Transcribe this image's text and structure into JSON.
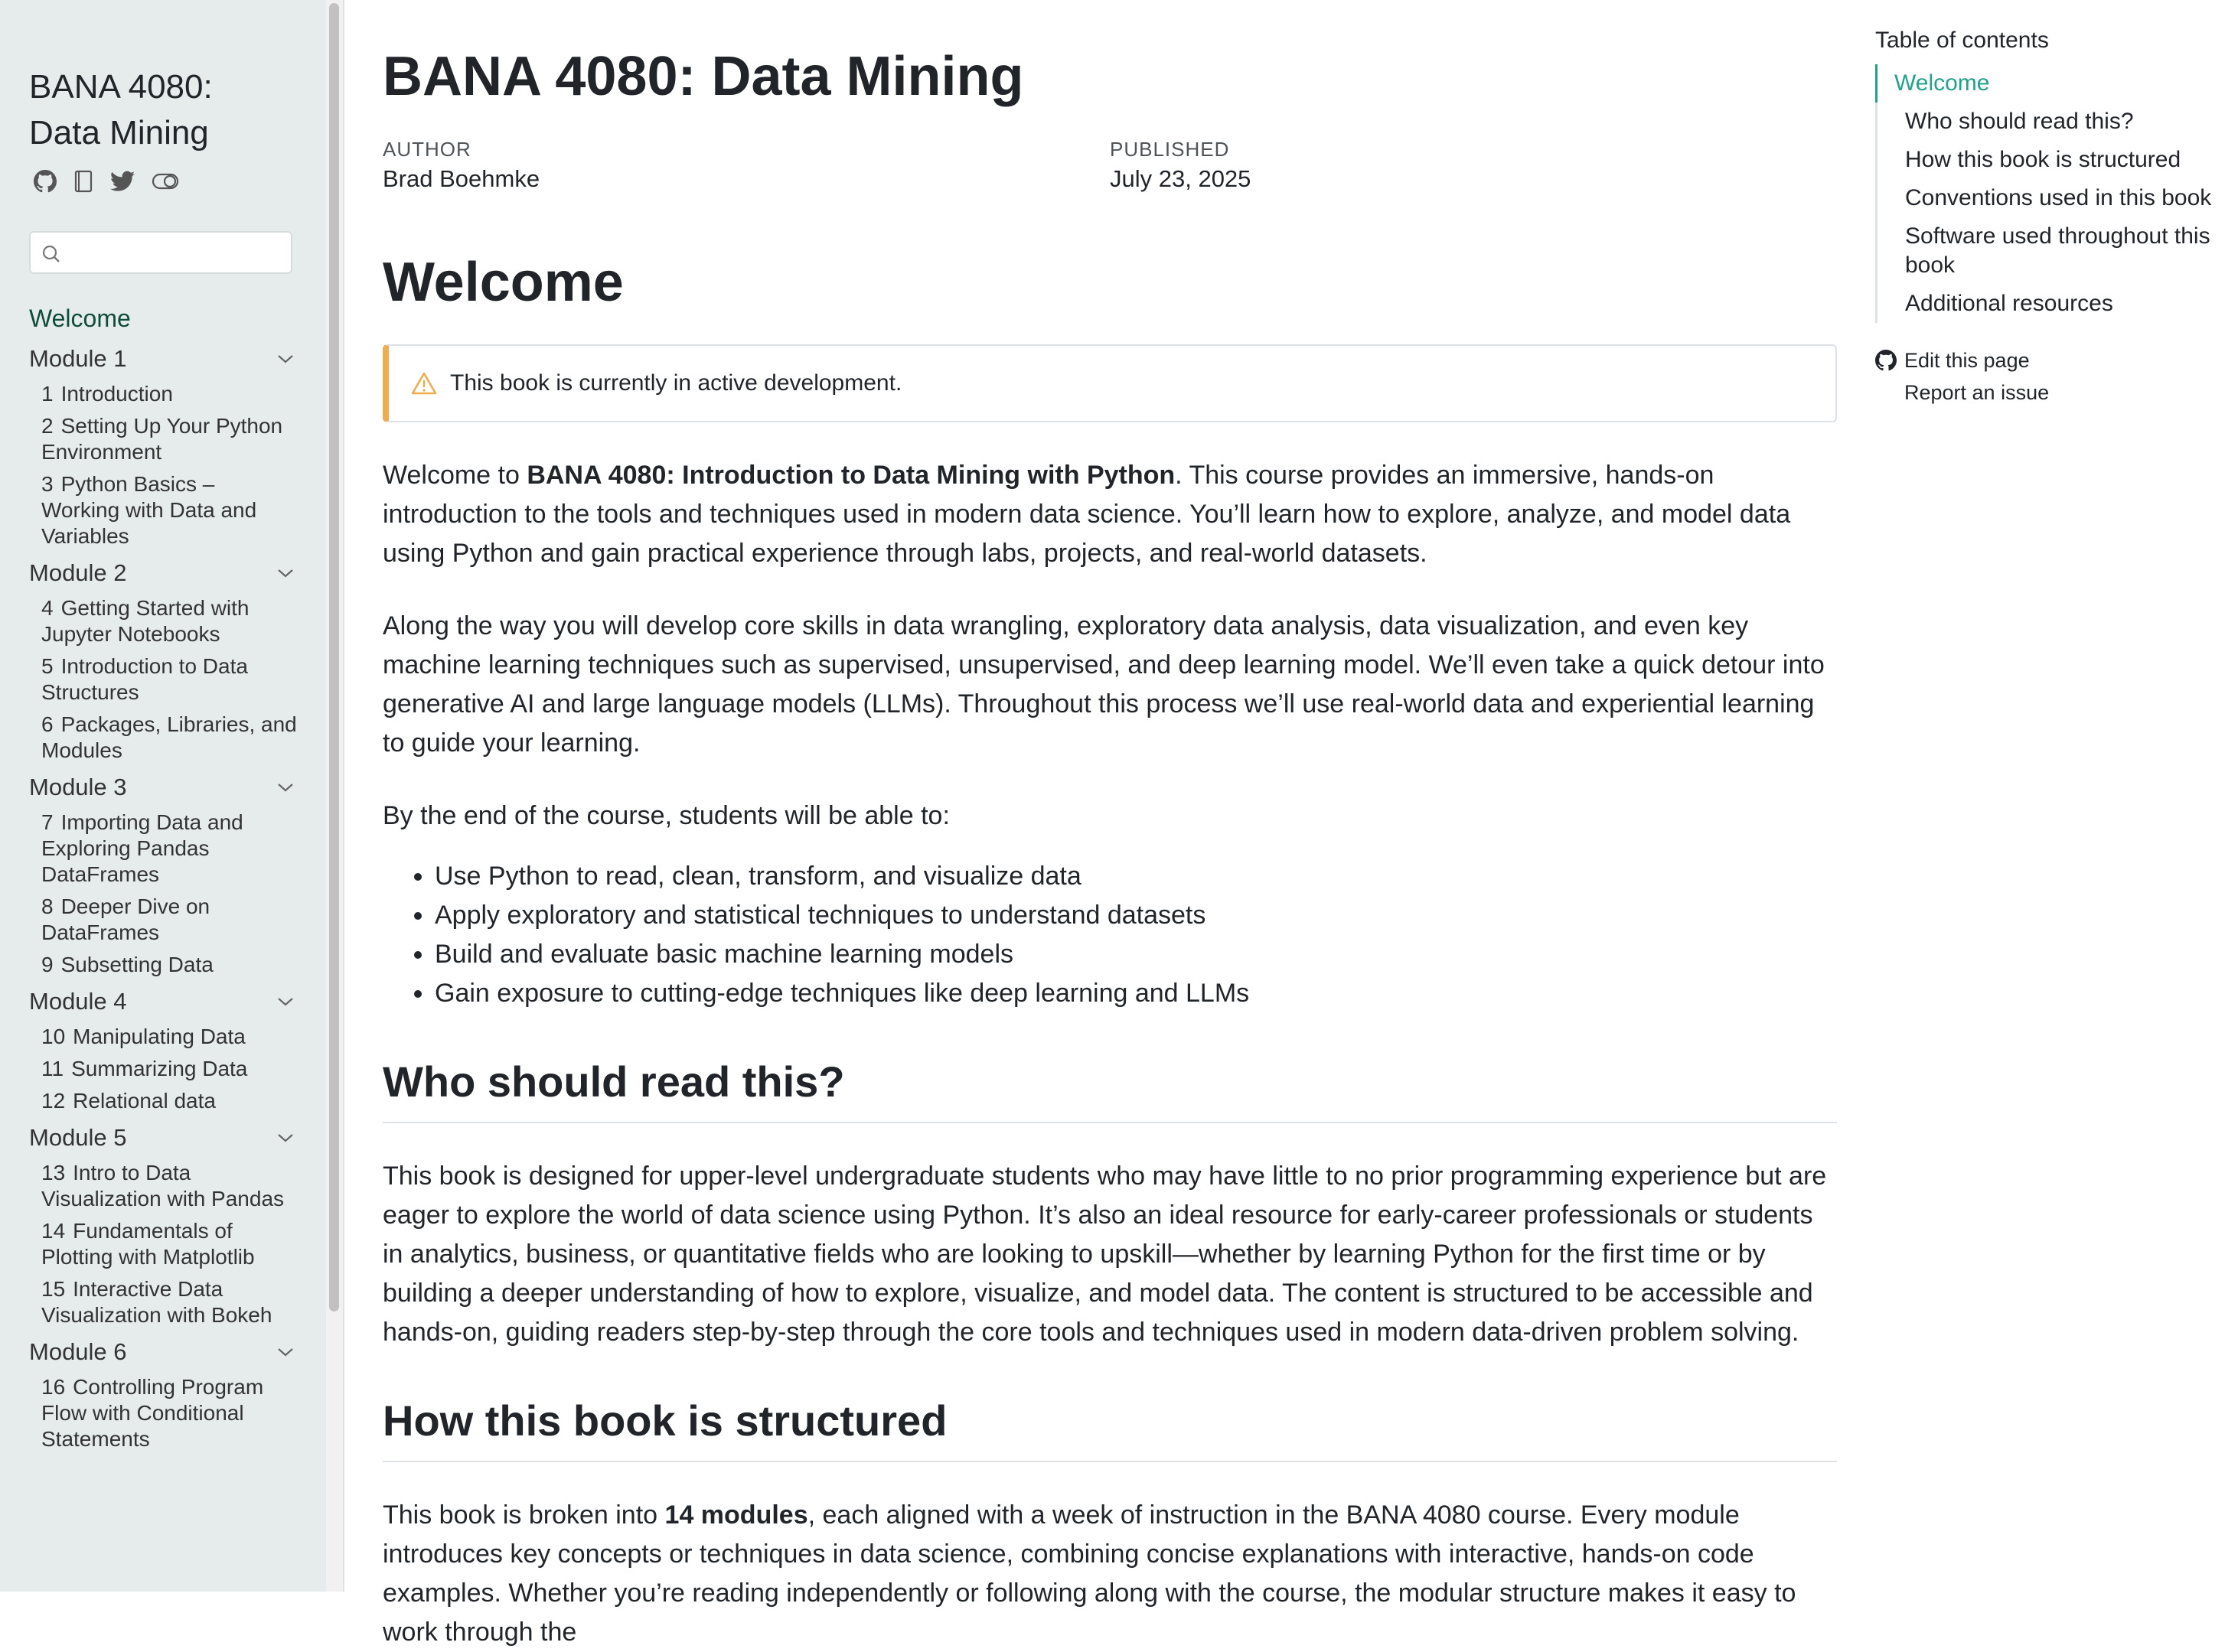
{
  "sidebar": {
    "title_line1": "BANA 4080:",
    "title_line2": "Data Mining",
    "icons": [
      "github-icon",
      "notebook-icon",
      "twitter-icon",
      "toggle-icon"
    ],
    "search_placeholder": "",
    "welcome": "Welcome",
    "modules": [
      {
        "label": "Module 1",
        "items": [
          {
            "num": "1",
            "label": "Introduction"
          },
          {
            "num": "2",
            "label": "Setting Up Your Python Environment"
          },
          {
            "num": "3",
            "label": "Python Basics – Working with Data and Variables"
          }
        ]
      },
      {
        "label": "Module 2",
        "items": [
          {
            "num": "4",
            "label": "Getting Started with Jupyter Notebooks"
          },
          {
            "num": "5",
            "label": "Introduction to Data Structures"
          },
          {
            "num": "6",
            "label": "Packages, Libraries, and Modules"
          }
        ]
      },
      {
        "label": "Module 3",
        "items": [
          {
            "num": "7",
            "label": "Importing Data and Exploring Pandas DataFrames"
          },
          {
            "num": "8",
            "label": "Deeper Dive on DataFrames"
          },
          {
            "num": "9",
            "label": "Subsetting Data"
          }
        ]
      },
      {
        "label": "Module 4",
        "items": [
          {
            "num": "10",
            "label": "Manipulating Data"
          },
          {
            "num": "11",
            "label": "Summarizing Data"
          },
          {
            "num": "12",
            "label": "Relational data"
          }
        ]
      },
      {
        "label": "Module 5",
        "items": [
          {
            "num": "13",
            "label": "Intro to Data Visualization with Pandas"
          },
          {
            "num": "14",
            "label": "Fundamentals of Plotting with Matplotlib"
          },
          {
            "num": "15",
            "label": "Interactive Data Visualization with Bokeh"
          }
        ]
      },
      {
        "label": "Module 6",
        "items": [
          {
            "num": "16",
            "label": "Controlling Program Flow with Conditional Statements"
          }
        ]
      }
    ]
  },
  "main": {
    "title": "BANA 4080: Data Mining",
    "author_label": "AUTHOR",
    "author": "Brad Boehmke",
    "published_label": "PUBLISHED",
    "published": "July 23, 2025",
    "welcome_heading": "Welcome",
    "callout": "This book is currently in active development.",
    "intro_pre": "Welcome to ",
    "intro_bold": "BANA 4080: Introduction to Data Mining with Python",
    "intro_post": ". This course provides an immersive, hands-on introduction to the tools and techniques used in modern data science. You’ll learn how to explore, analyze, and model data using Python and gain practical experience through labs, projects, and real-world datasets.",
    "para2": "Along the way you will develop core skills in data wrangling, exploratory data analysis, data visualization, and even key machine learning techniques such as supervised, unsupervised, and deep learning model. We’ll even take a quick detour into generative AI and large language models (LLMs). Throughout this process we’ll use real-world data and experiential learning to guide your learning.",
    "para3": "By the end of the course, students will be able to:",
    "bullets": [
      "Use Python to read, clean, transform, and visualize data",
      "Apply exploratory and statistical techniques to understand datasets",
      "Build and evaluate basic machine learning models",
      "Gain exposure to cutting-edge techniques like deep learning and LLMs"
    ],
    "h_who": "Who should read this?",
    "who_para": "This book is designed for upper-level undergraduate students who may have little to no prior programming experience but are eager to explore the world of data science using Python. It’s also an ideal resource for early-career professionals or students in analytics, business, or quantitative fields who are looking to upskill—whether by learning Python for the first time or by building a deeper understanding of how to explore, visualize, and model data. The content is structured to be accessible and hands-on, guiding readers step-by-step through the core tools and techniques used in modern data-driven problem solving.",
    "h_how": "How this book is structured",
    "how_pre": "This book is broken into ",
    "how_bold": "14 modules",
    "how_post": ", each aligned with a week of instruction in the BANA 4080 course. Every module introduces key concepts or techniques in data science, combining concise explanations with interactive, hands-on code examples. Whether you’re reading independently or following along with the course, the modular structure makes it easy to work through the"
  },
  "toc": {
    "title": "Table of contents",
    "items": [
      "Welcome",
      "Who should read this?",
      "How this book is structured",
      "Conventions used in this book",
      "Software used throughout this book",
      "Additional resources"
    ],
    "edit_link": "Edit this page",
    "issue_link": "Report an issue"
  },
  "colors": {
    "sidebar_bg": "#e6ecec",
    "accent": "#21a38a",
    "warning": "#f0ad4e"
  }
}
